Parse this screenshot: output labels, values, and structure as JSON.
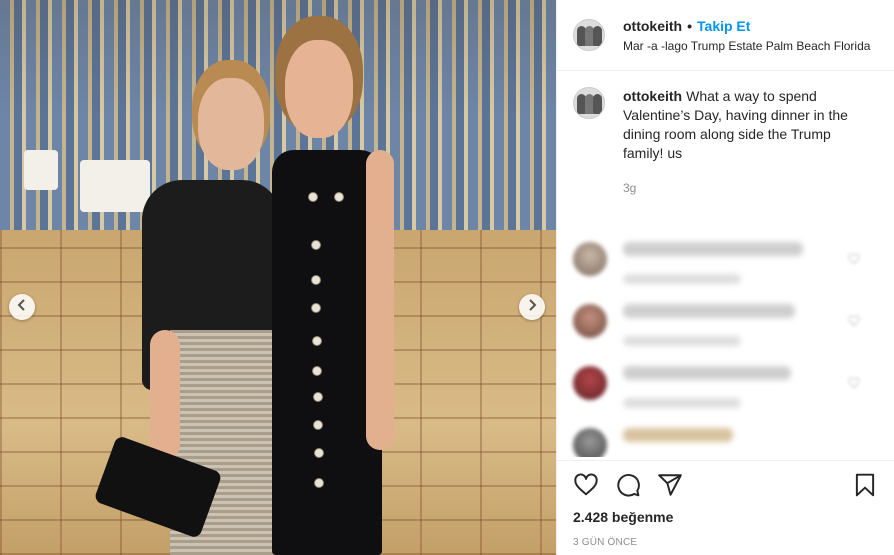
{
  "post": {
    "username": "ottokeith",
    "separator": "•",
    "follow_label": "Takip Et",
    "location": "Mar -a -lago Trump Estate Palm Beach Florida",
    "caption_username": "ottokeith",
    "caption_text": "What a way to spend Valentine’s Day, having dinner in the dining room along side the Trump family! us",
    "caption_time": "3g",
    "likes": "2.428 beğenme",
    "posted_ago": "3 GÜN ÖNCE"
  },
  "icons": {
    "like": "heart-icon",
    "comment": "comment-icon",
    "share": "share-icon",
    "save": "bookmark-icon",
    "prev": "chevron-left-icon",
    "next": "chevron-right-icon"
  },
  "colors": {
    "accent": "#0095f6",
    "text": "#262626",
    "muted": "#8e8e8e"
  }
}
